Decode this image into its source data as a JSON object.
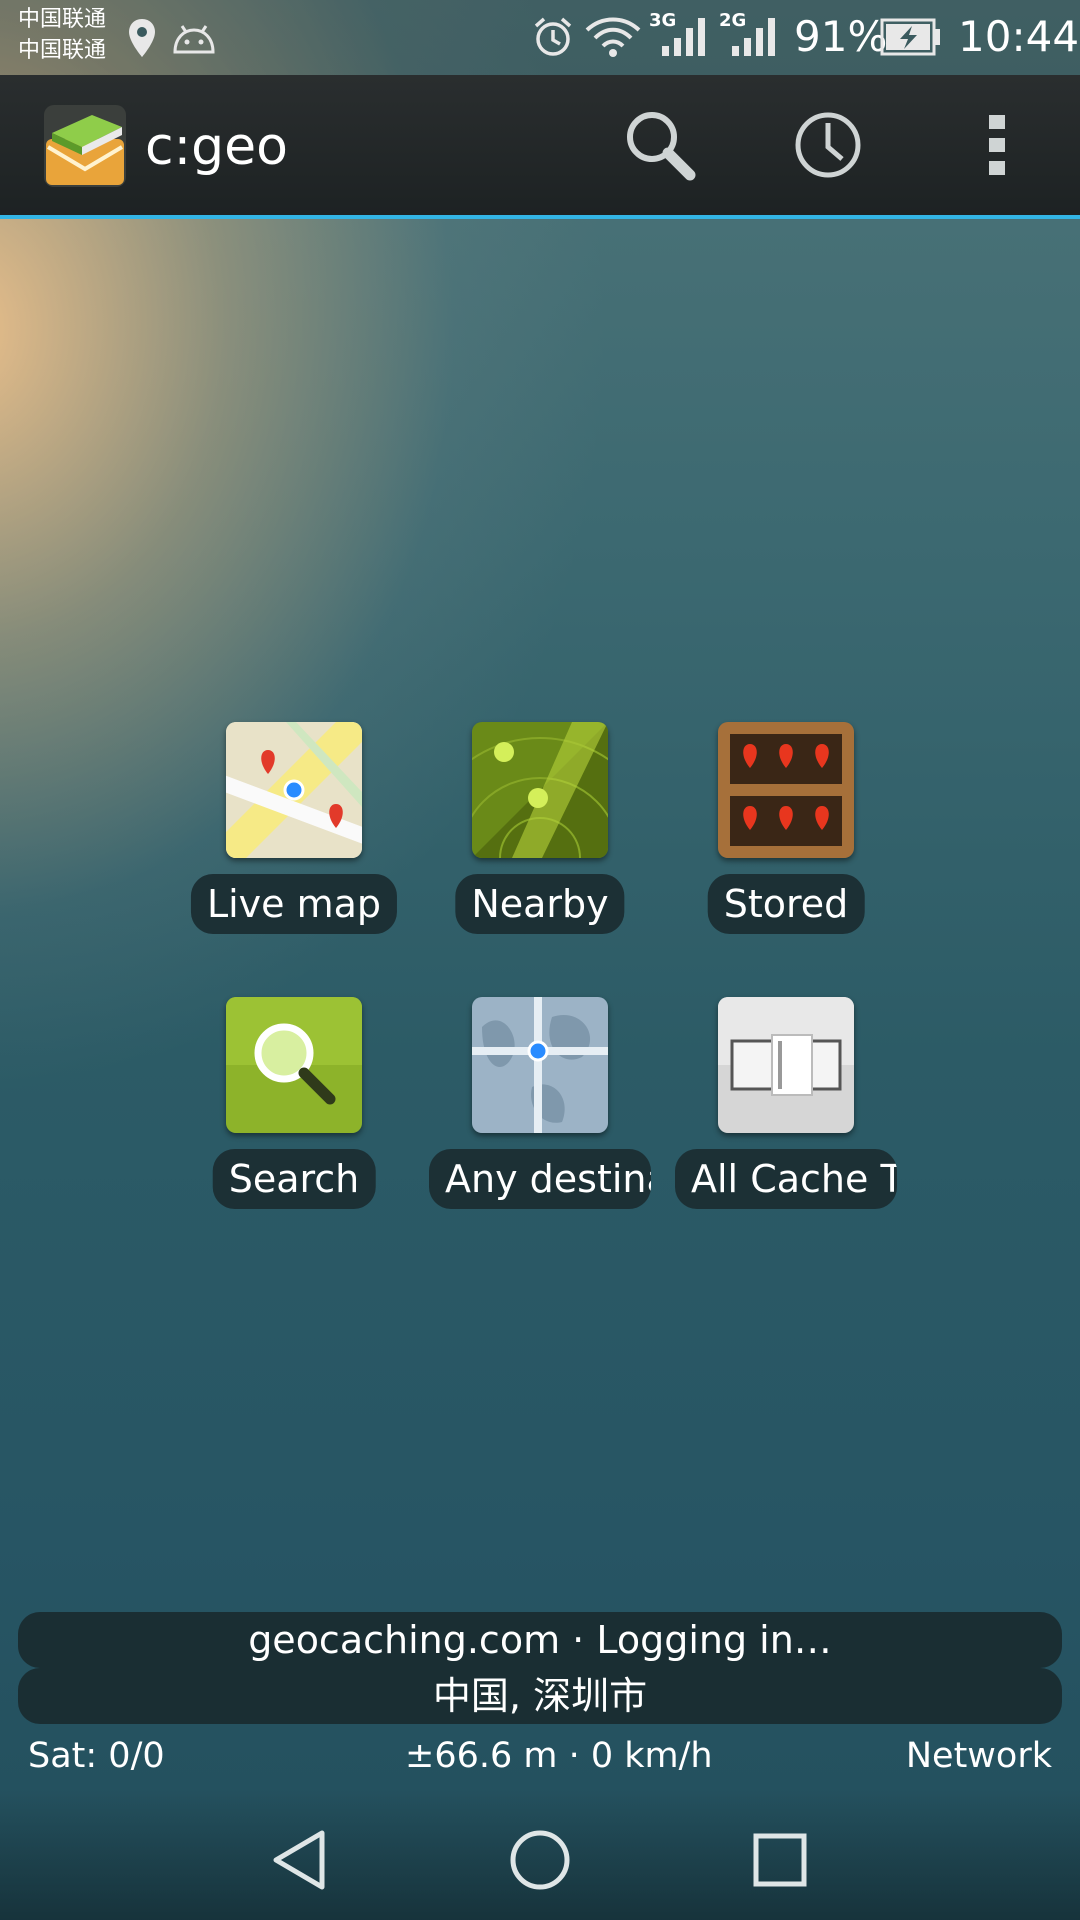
{
  "status_bar": {
    "carrier_1": "中国联通",
    "carrier_2": "中国联通",
    "network_1": "3G",
    "network_2": "2G",
    "battery": "91%",
    "time": "10:44",
    "icons": [
      "location-pin-icon",
      "android-icon",
      "alarm-icon",
      "wifi-icon",
      "signal-3g-icon",
      "signal-2g-icon",
      "battery-charging-icon"
    ]
  },
  "action_bar": {
    "title": "c:geo",
    "actions": [
      "search-icon",
      "history-icon",
      "overflow-menu-icon"
    ]
  },
  "menu": {
    "items": [
      {
        "label": "Live map",
        "icon": "live-map-icon"
      },
      {
        "label": "Nearby",
        "icon": "nearby-radar-icon"
      },
      {
        "label": "Stored",
        "icon": "stored-shelf-icon"
      },
      {
        "label": "Search",
        "icon": "search-magnifier-icon"
      },
      {
        "label": "Any destination",
        "icon": "any-destination-icon"
      },
      {
        "label": "All Cache Types",
        "icon": "cache-type-filter-icon"
      }
    ]
  },
  "status": {
    "login_text": "geocaching.com · Logging in…",
    "location_text": "中国, 深圳市",
    "satellites": "Sat: 0/0",
    "accuracy_speed": "±66.6 m · 0 km/h",
    "provider": "Network"
  },
  "nav_bar": {
    "buttons": [
      "back-icon",
      "home-icon",
      "recents-icon"
    ]
  },
  "colors": {
    "accent": "#33b5e5",
    "label_bg": "#1c3035",
    "action_bar": "#1f2425"
  }
}
